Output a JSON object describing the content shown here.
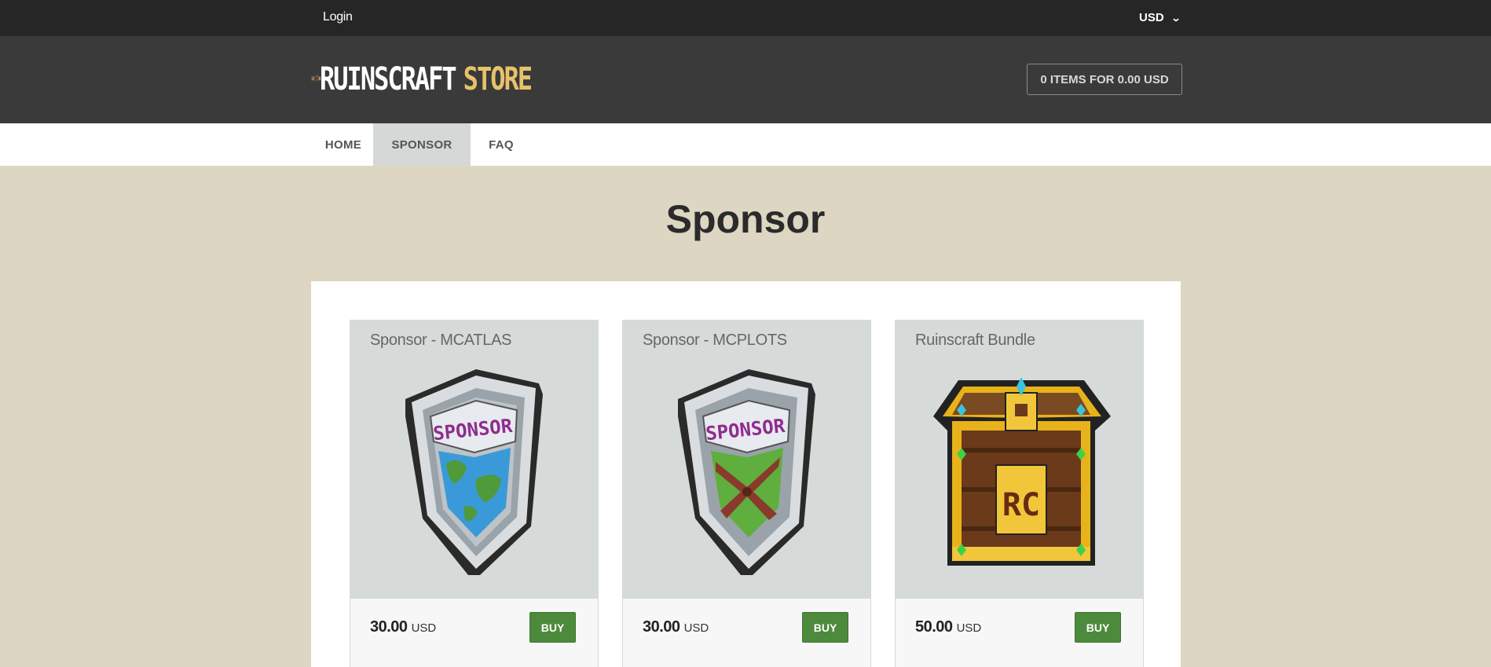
{
  "topbar": {
    "login": "Login",
    "currency": "USD"
  },
  "header": {
    "logo_text_main": "RUINSCRAFT",
    "logo_text_store": "STORE",
    "cart": "0 ITEMS FOR 0.00 USD"
  },
  "nav": {
    "items": [
      {
        "label": "HOME"
      },
      {
        "label": "SPONSOR",
        "active": true
      },
      {
        "label": "FAQ"
      }
    ]
  },
  "page": {
    "title": "Sponsor"
  },
  "products": [
    {
      "title": "Sponsor - MCATLAS",
      "price": "30.00",
      "currency": "USD",
      "buy": "BUY",
      "badge_text": "SPONSOR",
      "icon": "sponsor-shield-globe-icon"
    },
    {
      "title": "Sponsor - MCPLOTS",
      "price": "30.00",
      "currency": "USD",
      "buy": "BUY",
      "badge_text": "SPONSOR",
      "icon": "sponsor-shield-plots-icon"
    },
    {
      "title": "Ruinscraft Bundle",
      "price": "50.00",
      "currency": "USD",
      "buy": "BUY",
      "badge_text": "RC",
      "icon": "treasure-chest-icon"
    }
  ],
  "colors": {
    "background": "#ddd6c3",
    "topbar": "#262626",
    "header": "#3a3a3a",
    "buy_button": "#4e8a3c",
    "store_accent": "#e8c26a"
  }
}
